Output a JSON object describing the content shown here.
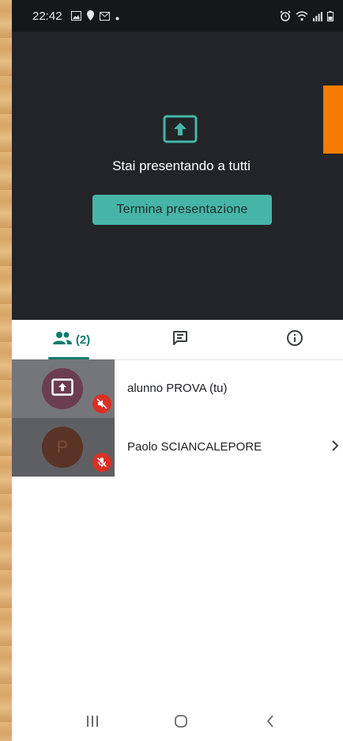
{
  "status_bar": {
    "time": "22:42",
    "left_icons": [
      "image-icon",
      "location-icon",
      "mail-icon",
      "dot-icon"
    ],
    "right_icons": [
      "alarm-icon",
      "wifi-icon",
      "signal-icon",
      "battery-icon"
    ]
  },
  "presentation": {
    "message": "Stai presentando a tutti",
    "stop_button": "Termina presentazione",
    "accent_color": "#46b5a8",
    "side_tab_color": "#f57c00"
  },
  "tabs": {
    "people_count": "(2)",
    "items": [
      "people-icon",
      "chat-icon",
      "info-icon"
    ]
  },
  "participants": [
    {
      "name": "alunno PROVA (tu)",
      "avatar": "present-screen-icon",
      "muted": "muted-speaker-icon"
    },
    {
      "name": "Paolo SCIANCALEPORE",
      "avatar_letter": "P",
      "muted": "muted-mic-icon"
    }
  ],
  "nav_bar": [
    "recent-apps-icon",
    "home-icon",
    "back-icon"
  ]
}
